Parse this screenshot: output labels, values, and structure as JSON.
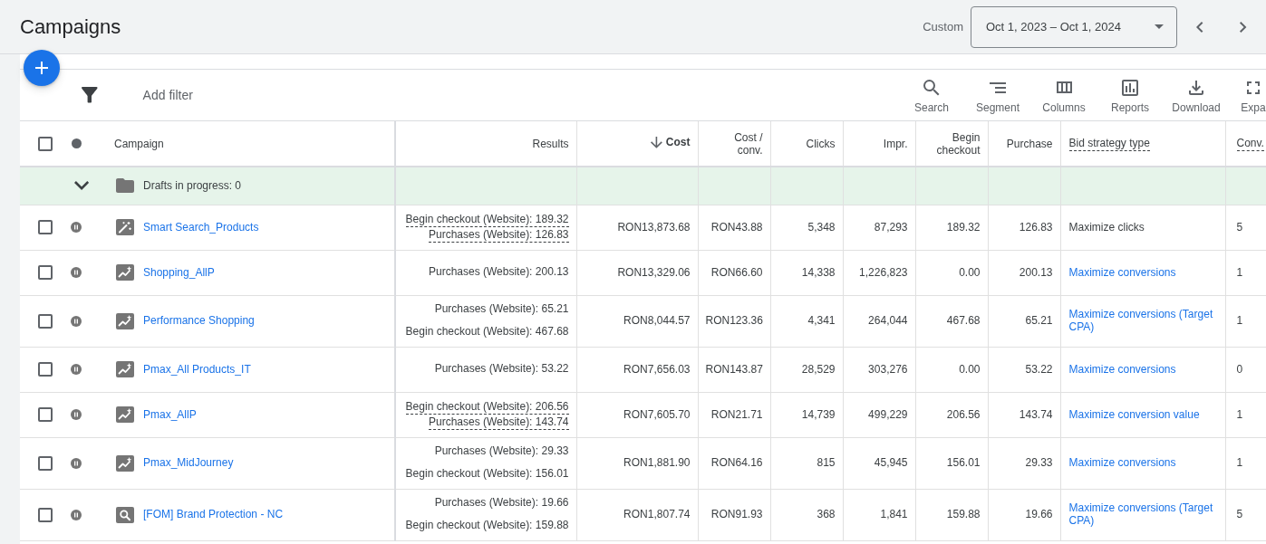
{
  "header": {
    "title": "Campaigns",
    "date_range": {
      "label": "Custom",
      "value": "Oct 1, 2023 – Oct 1, 2024"
    }
  },
  "filter_bar": {
    "add_filter": "Add filter"
  },
  "toolbar": [
    {
      "kind": "search",
      "label": "Search"
    },
    {
      "kind": "segment",
      "label": "Segment"
    },
    {
      "kind": "columns",
      "label": "Columns"
    },
    {
      "kind": "reports",
      "label": "Reports"
    },
    {
      "kind": "download",
      "label": "Download"
    },
    {
      "kind": "expand",
      "label": "Expa"
    }
  ],
  "table": {
    "header": {
      "checked": false,
      "campaign": "Campaign"
    },
    "columns": [
      {
        "label": "Results",
        "kind": "number",
        "sorted": false,
        "underlined": false
      },
      {
        "label": "Cost",
        "kind": "number",
        "sorted": true,
        "underlined": false
      },
      {
        "label": "Cost / conv.",
        "kind": "number",
        "sorted": false,
        "underlined": false
      },
      {
        "label": "Clicks",
        "kind": "number",
        "sorted": false,
        "underlined": false
      },
      {
        "label": "Impr.",
        "kind": "number",
        "sorted": false,
        "underlined": false
      },
      {
        "label": "Begin checkout",
        "kind": "number",
        "sorted": false,
        "underlined": false
      },
      {
        "label": "Purchase",
        "kind": "number",
        "sorted": false,
        "underlined": false
      },
      {
        "label": "Bid strategy type",
        "kind": "text",
        "sorted": false,
        "underlined": true
      },
      {
        "label": "Conv.",
        "kind": "text",
        "sorted": false,
        "underlined": true
      }
    ],
    "drafts": {
      "label": "Drafts in progress: 0"
    },
    "rows": [
      {
        "checked": false,
        "paused": true,
        "kind": "smart",
        "name": "Smart Search_Products",
        "results_underlined": true,
        "results": [
          "Begin checkout (Website): 189.32",
          "Purchases (Website): 126.83"
        ],
        "values": [
          "RON13,873.68",
          "RON43.88",
          "5,348",
          "87,293",
          "189.32",
          "126.83"
        ],
        "bid_strategy": {
          "text": "Maximize clicks",
          "link": false
        },
        "conv": "5"
      },
      {
        "checked": false,
        "paused": true,
        "kind": "performance",
        "name": "Shopping_AllP",
        "results_underlined": false,
        "results": [
          "Purchases (Website): 200.13"
        ],
        "values": [
          "RON13,329.06",
          "RON66.60",
          "14,338",
          "1,226,823",
          "0.00",
          "200.13"
        ],
        "bid_strategy": {
          "text": "Maximize conversions",
          "link": true
        },
        "conv": "1"
      },
      {
        "checked": false,
        "paused": true,
        "kind": "performance",
        "name": "Performance Shopping",
        "results_underlined": false,
        "results": [
          "Purchases (Website): 65.21",
          "Begin checkout (Website): 467.68"
        ],
        "values": [
          "RON8,044.57",
          "RON123.36",
          "4,341",
          "264,044",
          "467.68",
          "65.21"
        ],
        "bid_strategy": {
          "text": "Maximize conversions (Target CPA)",
          "link": true
        },
        "conv": "1"
      },
      {
        "checked": false,
        "paused": true,
        "kind": "performance",
        "name": "Pmax_All Products_IT",
        "results_underlined": false,
        "results": [
          "Purchases (Website): 53.22"
        ],
        "values": [
          "RON7,656.03",
          "RON143.87",
          "28,529",
          "303,276",
          "0.00",
          "53.22"
        ],
        "bid_strategy": {
          "text": "Maximize conversions",
          "link": true
        },
        "conv": "0"
      },
      {
        "checked": false,
        "paused": true,
        "kind": "performance",
        "name": "Pmax_AllP",
        "results_underlined": true,
        "results": [
          "Begin checkout (Website): 206.56",
          "Purchases (Website): 143.74"
        ],
        "values": [
          "RON7,605.70",
          "RON21.71",
          "14,739",
          "499,229",
          "206.56",
          "143.74"
        ],
        "bid_strategy": {
          "text": "Maximize conversion value",
          "link": true
        },
        "conv": "1"
      },
      {
        "checked": false,
        "paused": true,
        "kind": "performance",
        "name": "Pmax_MidJourney",
        "results_underlined": false,
        "results": [
          "Purchases (Website): 29.33",
          "Begin checkout (Website): 156.01"
        ],
        "values": [
          "RON1,881.90",
          "RON64.16",
          "815",
          "45,945",
          "156.01",
          "29.33"
        ],
        "bid_strategy": {
          "text": "Maximize conversions",
          "link": true
        },
        "conv": "1"
      },
      {
        "checked": false,
        "paused": true,
        "kind": "search",
        "name": "[FOM] Brand Protection - NC",
        "results_underlined": false,
        "results": [
          "Purchases (Website): 19.66",
          "Begin checkout (Website): 159.88"
        ],
        "values": [
          "RON1,807.74",
          "RON91.93",
          "368",
          "1,841",
          "159.88",
          "19.66"
        ],
        "bid_strategy": {
          "text": "Maximize conversions (Target CPA)",
          "link": true
        },
        "conv": "5"
      }
    ]
  }
}
